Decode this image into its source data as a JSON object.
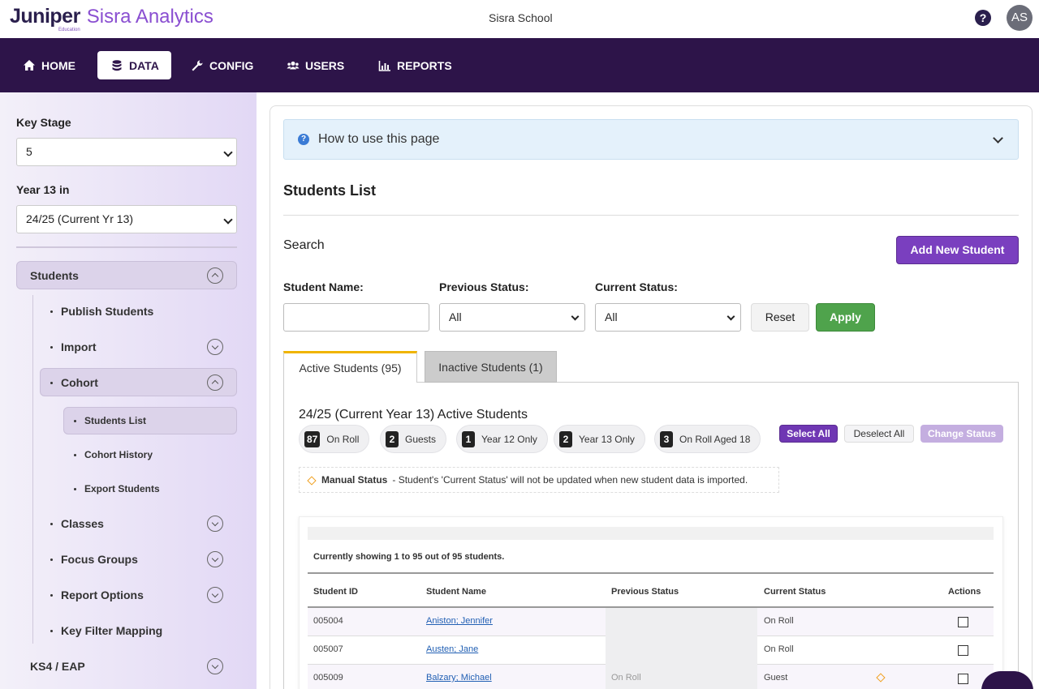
{
  "header": {
    "logo_main": "Juniper",
    "logo_sub": "Education",
    "app_name": "Sisra Analytics",
    "school": "Sisra School",
    "help_icon": "?",
    "avatar_initials": "AS"
  },
  "nav": {
    "items": [
      {
        "label": "HOME",
        "icon": "home-icon"
      },
      {
        "label": "DATA",
        "icon": "database-icon",
        "active": true
      },
      {
        "label": "CONFIG",
        "icon": "wrench-icon"
      },
      {
        "label": "USERS",
        "icon": "users-icon"
      },
      {
        "label": "REPORTS",
        "icon": "bar-chart-icon"
      }
    ]
  },
  "sidebar": {
    "key_stage_label": "Key Stage",
    "key_stage_value": "5",
    "year_label": "Year 13 in",
    "year_value": "24/25 (Current Yr 13)",
    "groups": {
      "students": "Students",
      "publish": "Publish Students",
      "import": "Import",
      "cohort": "Cohort",
      "students_list": "Students List",
      "cohort_history": "Cohort History",
      "export_students": "Export Students",
      "classes": "Classes",
      "focus_groups": "Focus Groups",
      "report_options": "Report Options",
      "key_filter_mapping": "Key Filter Mapping",
      "ks4": "KS4 / EAP"
    }
  },
  "main": {
    "howto": "How to use this page",
    "title": "Students List",
    "search_label": "Search",
    "add_button": "Add New Student",
    "filters": {
      "student_name_label": "Student Name:",
      "student_name_value": "",
      "previous_status_label": "Previous Status:",
      "previous_status_value": "All",
      "current_status_label": "Current Status:",
      "current_status_value": "All",
      "reset": "Reset",
      "apply": "Apply"
    },
    "tabs": {
      "active": "Active Students (95)",
      "inactive": "Inactive Students (1)"
    },
    "panel_title": "24/25 (Current Year 13) Active Students",
    "pills": [
      {
        "count": "87",
        "label": "On Roll"
      },
      {
        "count": "2",
        "label": "Guests"
      },
      {
        "count": "1",
        "label": "Year 12 Only"
      },
      {
        "count": "2",
        "label": "Year 13 Only"
      },
      {
        "count": "3",
        "label": "On Roll Aged 18"
      }
    ],
    "select_all": "Select All",
    "deselect_all": "Deselect All",
    "change_status": "Change Status",
    "manual_status_title": "Manual Status",
    "manual_status_text": "- Student's 'Current Status' will not be updated when new student data is imported.",
    "showing": "Currently showing 1 to 95 out of 95 students.",
    "columns": [
      "Student ID",
      "Student Name",
      "Previous Status",
      "Current Status",
      "Actions"
    ],
    "rows": [
      {
        "id": "005004",
        "name": "Aniston; Jennifer",
        "previous": "",
        "current": "On Roll"
      },
      {
        "id": "005007",
        "name": "Austen; Jane",
        "previous": "",
        "current": "On Roll"
      },
      {
        "id": "005009",
        "name": "Balzary; Michael",
        "previous": "On Roll",
        "current": "Guest"
      }
    ]
  },
  "colors": {
    "nav_bg": "#2d1449",
    "brand_purple": "#8a4fd1",
    "primary_button": "#7a3fbf",
    "apply_green": "#4fa34c",
    "tab_accent": "#f0b400",
    "manual_diamond": "#f0a020"
  }
}
